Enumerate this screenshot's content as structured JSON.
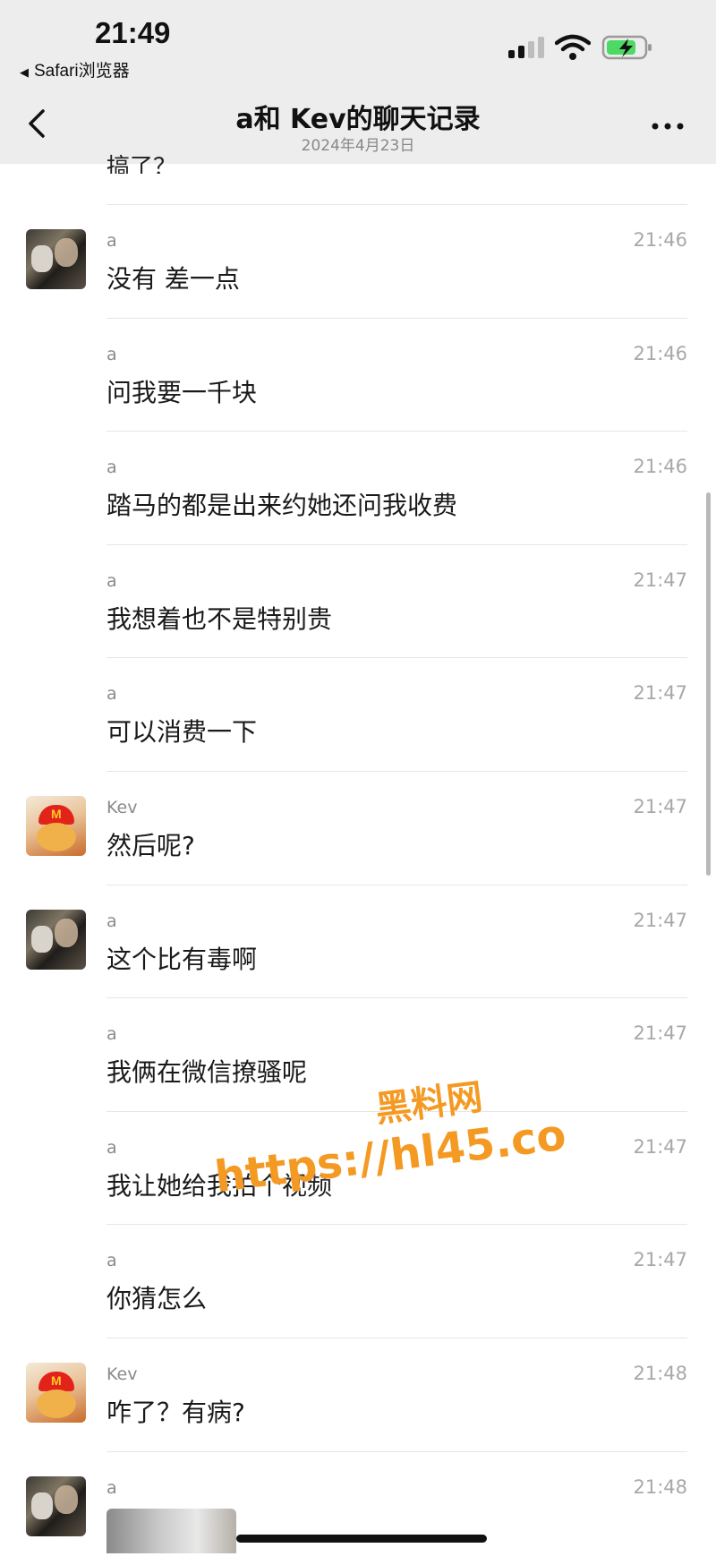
{
  "status_bar": {
    "time": "21:49",
    "back_app": "Safari浏览器"
  },
  "header": {
    "title": "a和 Kev的聊天记录",
    "date": "2024年4月23日"
  },
  "partial_previous_text": "搞了？",
  "messages": [
    {
      "sender": "a",
      "time": "21:46",
      "text": "没有 差一点",
      "avatar": "a"
    },
    {
      "sender": "a",
      "time": "21:46",
      "text": "问我要一千块",
      "avatar": ""
    },
    {
      "sender": "a",
      "time": "21:46",
      "text": "踏马的都是出来约她还问我收费",
      "avatar": ""
    },
    {
      "sender": "a",
      "time": "21:47",
      "text": "我想着也不是特别贵",
      "avatar": ""
    },
    {
      "sender": "a",
      "time": "21:47",
      "text": "可以消费一下",
      "avatar": ""
    },
    {
      "sender": "Kev",
      "time": "21:47",
      "text": "然后呢?",
      "avatar": "kev"
    },
    {
      "sender": "a",
      "time": "21:47",
      "text": "这个比有毒啊",
      "avatar": "a"
    },
    {
      "sender": "a",
      "time": "21:47",
      "text": "我俩在微信撩骚呢",
      "avatar": ""
    },
    {
      "sender": "a",
      "time": "21:47",
      "text": "我让她给我拍个视频",
      "avatar": ""
    },
    {
      "sender": "a",
      "time": "21:47",
      "text": "你猜怎么",
      "avatar": ""
    },
    {
      "sender": "Kev",
      "time": "21:48",
      "text": "咋了？有病?",
      "avatar": "kev"
    },
    {
      "sender": "a",
      "time": "21:48",
      "text": "",
      "avatar": "a"
    }
  ],
  "watermark": {
    "line1": "黑料网",
    "line2": "https://hl45.co"
  },
  "colors": {
    "header_bg": "#ededed",
    "watermark": "#f49a23"
  }
}
